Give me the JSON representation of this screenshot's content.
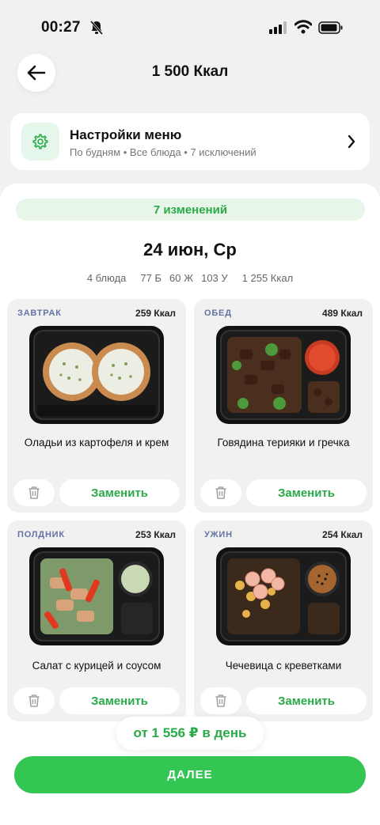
{
  "status_bar": {
    "time": "00:27"
  },
  "header": {
    "title": "1 500 Ккал"
  },
  "menu_settings": {
    "title": "Настройки меню",
    "subtitle": "По будням • Все блюда • 7 исключений"
  },
  "changes_badge": "7 изменений",
  "day": {
    "title": "24 июн, Ср",
    "dish_count": "4 блюда",
    "protein": "77 Б",
    "fat": "60 Ж",
    "carbs": "103 У",
    "kcal": "1 255 Ккал"
  },
  "meals": [
    {
      "label": "ЗАВТРАК",
      "kcal": "259 Ккал",
      "name": "Оладьи из картофеля и крем",
      "replace_label": "Заменить"
    },
    {
      "label": "ОБЕД",
      "kcal": "489 Ккал",
      "name": "Говядина терияки и гречка",
      "replace_label": "Заменить"
    },
    {
      "label": "ПОЛДНИК",
      "kcal": "253 Ккал",
      "name": "Салат с курицей и соусом",
      "replace_label": "Заменить"
    },
    {
      "label": "УЖИН",
      "kcal": "254 Ккал",
      "name": "Чечевица с креветками",
      "replace_label": "Заменить"
    }
  ],
  "price": "от 1 556 ₽ в день",
  "next_button": "ДАЛЕЕ",
  "colors": {
    "accent": "#33c653",
    "accent_text": "#2aaa48",
    "meal_label": "#6473a6"
  }
}
